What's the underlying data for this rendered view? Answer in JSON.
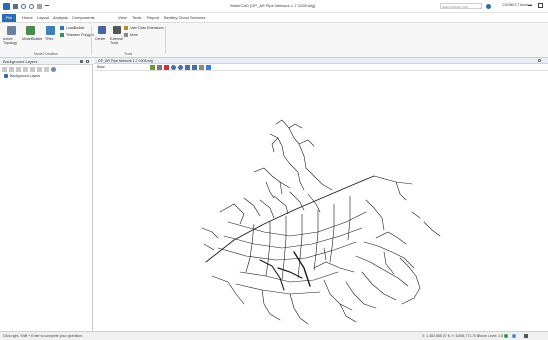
{
  "window": {
    "title": "WaterCAD [OP_AR Pipe Network 1-7 0208.wtg]",
    "search_placeholder": "Search Ribbon (F4)",
    "connect_label": "CONNECT Advisor"
  },
  "tabs": [
    "File",
    "Home",
    "Layout",
    "Analysis",
    "Components",
    "View",
    "Tools",
    "Report",
    "Bentley Cloud Services"
  ],
  "ribbon": {
    "group1": {
      "active_topology_label": "Active Topology",
      "modelbuilder_label": "ModelBuilder",
      "tregs_label": "TRex",
      "loadbuilder_label": "LoadBuilder",
      "thiessen_label": "Thiessen Polygon",
      "title": "Model Creation"
    },
    "group2": {
      "center_label": "Center",
      "external_tools_label": "External Tools",
      "user_data_label": "User Data Extensions",
      "more_label": "More",
      "title": "Tools"
    }
  },
  "left_panel": {
    "title": "Background Layers",
    "tree_item": "Background Layers"
  },
  "doc": {
    "tab_label": "OP_AR Pipe Network 1-7 0208.wtg",
    "view_label": "Base",
    "zoom_label": "Zoom Level: 2.8 %"
  },
  "status": {
    "left_text": "Click right, Shift + Enter to complete your operation.",
    "coords_text": "X: 1,482,865.07 ft, Y: 6,896,771.70 ft",
    "zoom_text": "Zoom Level: 2.8 %"
  },
  "colors": {
    "accent": "#2b6cb0",
    "network_line": "#1a1a1a"
  }
}
